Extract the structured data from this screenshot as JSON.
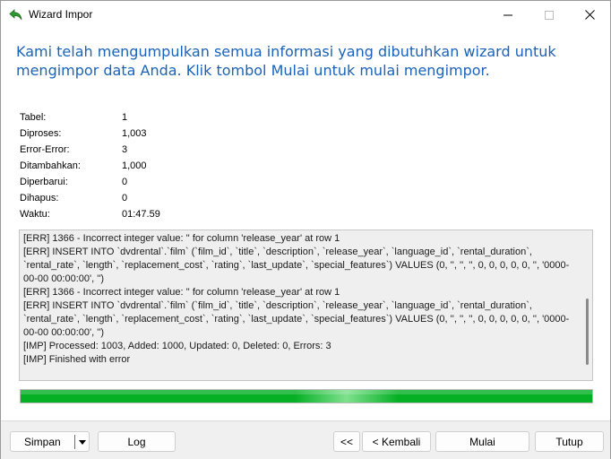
{
  "window": {
    "title": "Wizard Impor",
    "icon": "back-arrow-green-icon"
  },
  "heading": "Kami telah mengumpulkan semua informasi yang dibutuhkan wizard untuk mengimpor data Anda. Klik tombol Mulai untuk mulai mengimpor.",
  "stats": [
    {
      "label": "Tabel:",
      "value": "1"
    },
    {
      "label": "Diproses:",
      "value": "1,003"
    },
    {
      "label": "Error-Error:",
      "value": "3"
    },
    {
      "label": "Ditambahkan:",
      "value": "1,000"
    },
    {
      "label": "Diperbarui:",
      "value": "0"
    },
    {
      "label": "Dihapus:",
      "value": "0"
    },
    {
      "label": "Waktu:",
      "value": "01:47.59"
    }
  ],
  "log": [
    "[ERR] 1366 - Incorrect integer value: '' for column 'release_year' at row 1",
    "[ERR] INSERT INTO `dvdrental`.`film` (`film_id`, `title`, `description`, `release_year`, `language_id`, `rental_duration`, `rental_rate`, `length`, `replacement_cost`, `rating`, `last_update`, `special_features`) VALUES (0, '', '', '', 0, 0, 0, 0, 0, '', '0000-00-00 00:00:00', '')",
    "[ERR] 1366 - Incorrect integer value: '' for column 'release_year' at row 1",
    "[ERR] INSERT INTO `dvdrental`.`film` (`film_id`, `title`, `description`, `release_year`, `language_id`, `rental_duration`, `rental_rate`, `length`, `replacement_cost`, `rating`, `last_update`, `special_features`) VALUES (0, '', '', '', 0, 0, 0, 0, 0, '', '0000-00-00 00:00:00', '')",
    "[IMP] Processed: 1003, Added: 1000, Updated: 0, Deleted: 0, Errors: 3",
    "[IMP] Finished with error"
  ],
  "progress": {
    "percent": 100,
    "color": "#06b025"
  },
  "colors": {
    "heading": "#1a63b8",
    "progress": "#06b025"
  },
  "buttons": {
    "save": "Simpan",
    "log": "Log",
    "first": "<<",
    "back": "< Kembali",
    "start": "Mulai",
    "close": "Tutup"
  }
}
